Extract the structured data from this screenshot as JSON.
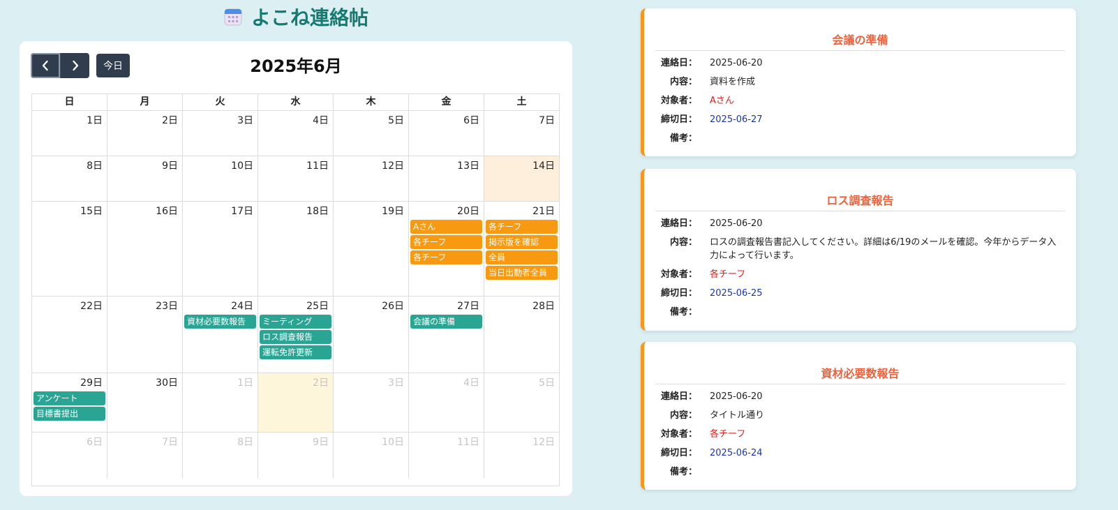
{
  "app": {
    "title": "よこね連絡帖"
  },
  "calendar": {
    "title": "2025年6月",
    "today_label": "今日",
    "weekdays": [
      "日",
      "月",
      "火",
      "水",
      "木",
      "金",
      "土"
    ],
    "weeks": [
      [
        {
          "label": "1日"
        },
        {
          "label": "2日"
        },
        {
          "label": "3日"
        },
        {
          "label": "4日"
        },
        {
          "label": "5日"
        },
        {
          "label": "6日"
        },
        {
          "label": "7日"
        }
      ],
      [
        {
          "label": "8日"
        },
        {
          "label": "9日"
        },
        {
          "label": "10日"
        },
        {
          "label": "11日"
        },
        {
          "label": "12日"
        },
        {
          "label": "13日"
        },
        {
          "label": "14日",
          "today": true
        }
      ],
      [
        {
          "label": "15日"
        },
        {
          "label": "16日"
        },
        {
          "label": "17日"
        },
        {
          "label": "18日"
        },
        {
          "label": "19日"
        },
        {
          "label": "20日",
          "events": [
            {
              "title": "Aさん",
              "color": "orange"
            },
            {
              "title": "各チーフ",
              "color": "orange"
            },
            {
              "title": "各チーフ",
              "color": "orange"
            }
          ]
        },
        {
          "label": "21日",
          "events": [
            {
              "title": "各チーフ",
              "color": "orange"
            },
            {
              "title": "掲示版を確認",
              "color": "orange"
            },
            {
              "title": "全員",
              "color": "orange"
            },
            {
              "title": "当日出勤者全員",
              "color": "orange"
            }
          ]
        }
      ],
      [
        {
          "label": "22日"
        },
        {
          "label": "23日"
        },
        {
          "label": "24日",
          "events": [
            {
              "title": "資材必要数報告",
              "color": "teal"
            }
          ]
        },
        {
          "label": "25日",
          "events": [
            {
              "title": "ミーティング",
              "color": "teal"
            },
            {
              "title": "ロス調査報告",
              "color": "teal"
            },
            {
              "title": "運転免許更新",
              "color": "teal"
            }
          ]
        },
        {
          "label": "26日"
        },
        {
          "label": "27日",
          "events": [
            {
              "title": "会議の準備",
              "color": "teal"
            }
          ]
        },
        {
          "label": "28日"
        }
      ],
      [
        {
          "label": "29日",
          "events": [
            {
              "title": "アンケート",
              "color": "teal"
            },
            {
              "title": "目標書提出",
              "color": "teal"
            }
          ]
        },
        {
          "label": "30日"
        },
        {
          "label": "1日",
          "other": true
        },
        {
          "label": "2日",
          "other": true,
          "highlight": true
        },
        {
          "label": "3日",
          "other": true
        },
        {
          "label": "4日",
          "other": true
        },
        {
          "label": "5日",
          "other": true
        }
      ],
      [
        {
          "label": "6日",
          "other": true
        },
        {
          "label": "7日",
          "other": true
        },
        {
          "label": "8日",
          "other": true
        },
        {
          "label": "9日",
          "other": true
        },
        {
          "label": "10日",
          "other": true
        },
        {
          "label": "11日",
          "other": true
        },
        {
          "label": "12日",
          "other": true
        }
      ]
    ]
  },
  "detail_cards": [
    {
      "title": "会議の準備",
      "fields": [
        {
          "label": "連絡日：",
          "value": "2025-06-20",
          "kind": "normal"
        },
        {
          "label": "内容：",
          "value": "資料を作成",
          "kind": "normal"
        },
        {
          "label": "対象者：",
          "value": "Aさん",
          "kind": "target"
        },
        {
          "label": "締切日：",
          "value": "2025-06-27",
          "kind": "deadline"
        },
        {
          "label": "備考：",
          "value": "",
          "kind": "normal"
        }
      ]
    },
    {
      "title": "ロス調査報告",
      "fields": [
        {
          "label": "連絡日：",
          "value": "2025-06-20",
          "kind": "normal"
        },
        {
          "label": "内容：",
          "value": "ロスの調査報告書記入してください。詳細は6/19のメールを確認。今年からデータ入力によって行います。",
          "kind": "normal"
        },
        {
          "label": "対象者：",
          "value": "各チーフ",
          "kind": "target"
        },
        {
          "label": "締切日：",
          "value": "2025-06-25",
          "kind": "deadline"
        },
        {
          "label": "備考：",
          "value": "",
          "kind": "normal"
        }
      ]
    },
    {
      "title": "資材必要数報告",
      "fields": [
        {
          "label": "連絡日：",
          "value": "2025-06-20",
          "kind": "normal"
        },
        {
          "label": "内容：",
          "value": "タイトル通り",
          "kind": "normal"
        },
        {
          "label": "対象者：",
          "value": "各チーフ",
          "kind": "target"
        },
        {
          "label": "締切日：",
          "value": "2025-06-24",
          "kind": "deadline"
        },
        {
          "label": "備考：",
          "value": "",
          "kind": "normal"
        }
      ]
    }
  ],
  "colors": {
    "event_orange": "#f79a12",
    "event_teal": "#2aa594",
    "card_accent": "#f7951d",
    "title_teal": "#177a72"
  },
  "icons": {
    "app": "calendar-icon",
    "prev": "chevron-left-icon",
    "next": "chevron-right-icon"
  }
}
